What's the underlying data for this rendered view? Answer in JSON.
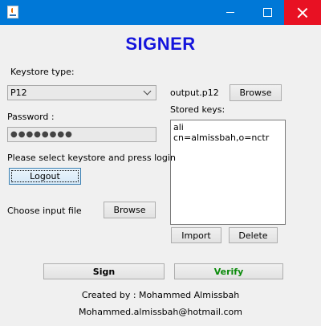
{
  "window": {
    "minimize_icon": "minimize-icon",
    "maximize_icon": "maximize-icon",
    "close_icon": "close-icon"
  },
  "header": {
    "title": "SIGNER"
  },
  "keystore": {
    "type_label": "Keystore type:",
    "type_value": "P12",
    "file_name": "output.p12",
    "browse_label": "Browse"
  },
  "password": {
    "label": "Password :",
    "masked_value": "●●●●●●●●"
  },
  "status": {
    "message": "Please select keystore and press login"
  },
  "login": {
    "logout_label": "Logout"
  },
  "input_file": {
    "label": "Choose input file",
    "browse_label": "Browse"
  },
  "stored_keys": {
    "label": "Stored keys:",
    "items": [
      "ali",
      "cn=almissbah,o=nctr"
    ],
    "import_label": "Import",
    "delete_label": "Delete"
  },
  "actions": {
    "sign_label": "Sign",
    "verify_label": "Verify"
  },
  "footer": {
    "credit": "Created by : Mohammed Almissbah",
    "email": "Mohammed.almissbah@hotmail.com"
  },
  "colors": {
    "titlebar": "#0078d7",
    "close": "#e81123",
    "heading": "#1414dc",
    "verify_text": "#0a8a0a"
  }
}
